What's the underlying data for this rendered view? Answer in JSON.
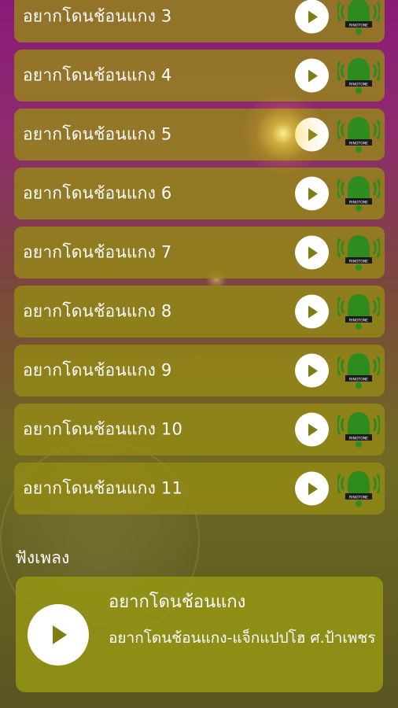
{
  "ringtones": [
    {
      "label": "อยากโดนช้อนแกง 3"
    },
    {
      "label": "อยากโดนช้อนแกง 4"
    },
    {
      "label": "อยากโดนช้อนแกง 5"
    },
    {
      "label": "อยากโดนช้อนแกง 6"
    },
    {
      "label": "อยากโดนช้อนแกง 7"
    },
    {
      "label": "อยากโดนช้อนแกง 8"
    },
    {
      "label": "อยากโดนช้อนแกง 9"
    },
    {
      "label": "อยากโดนช้อนแกง 10"
    },
    {
      "label": "อยากโดนช้อนแกง 11"
    }
  ],
  "icons": {
    "play": "play-icon",
    "ringtone": "ringtone-bell-icon"
  },
  "listen": {
    "section_title": "ฟังเพลง",
    "song_title": "อยากโดนช้อนแกง",
    "song_subtitle": "อยากโดนช้อนแกง-แจ็กแปปโฮ ศ.ป้าเพชร"
  },
  "colors": {
    "card": "#968c14",
    "bell_green": "#2e8b1e",
    "play_arrow": "#7d7d14"
  }
}
